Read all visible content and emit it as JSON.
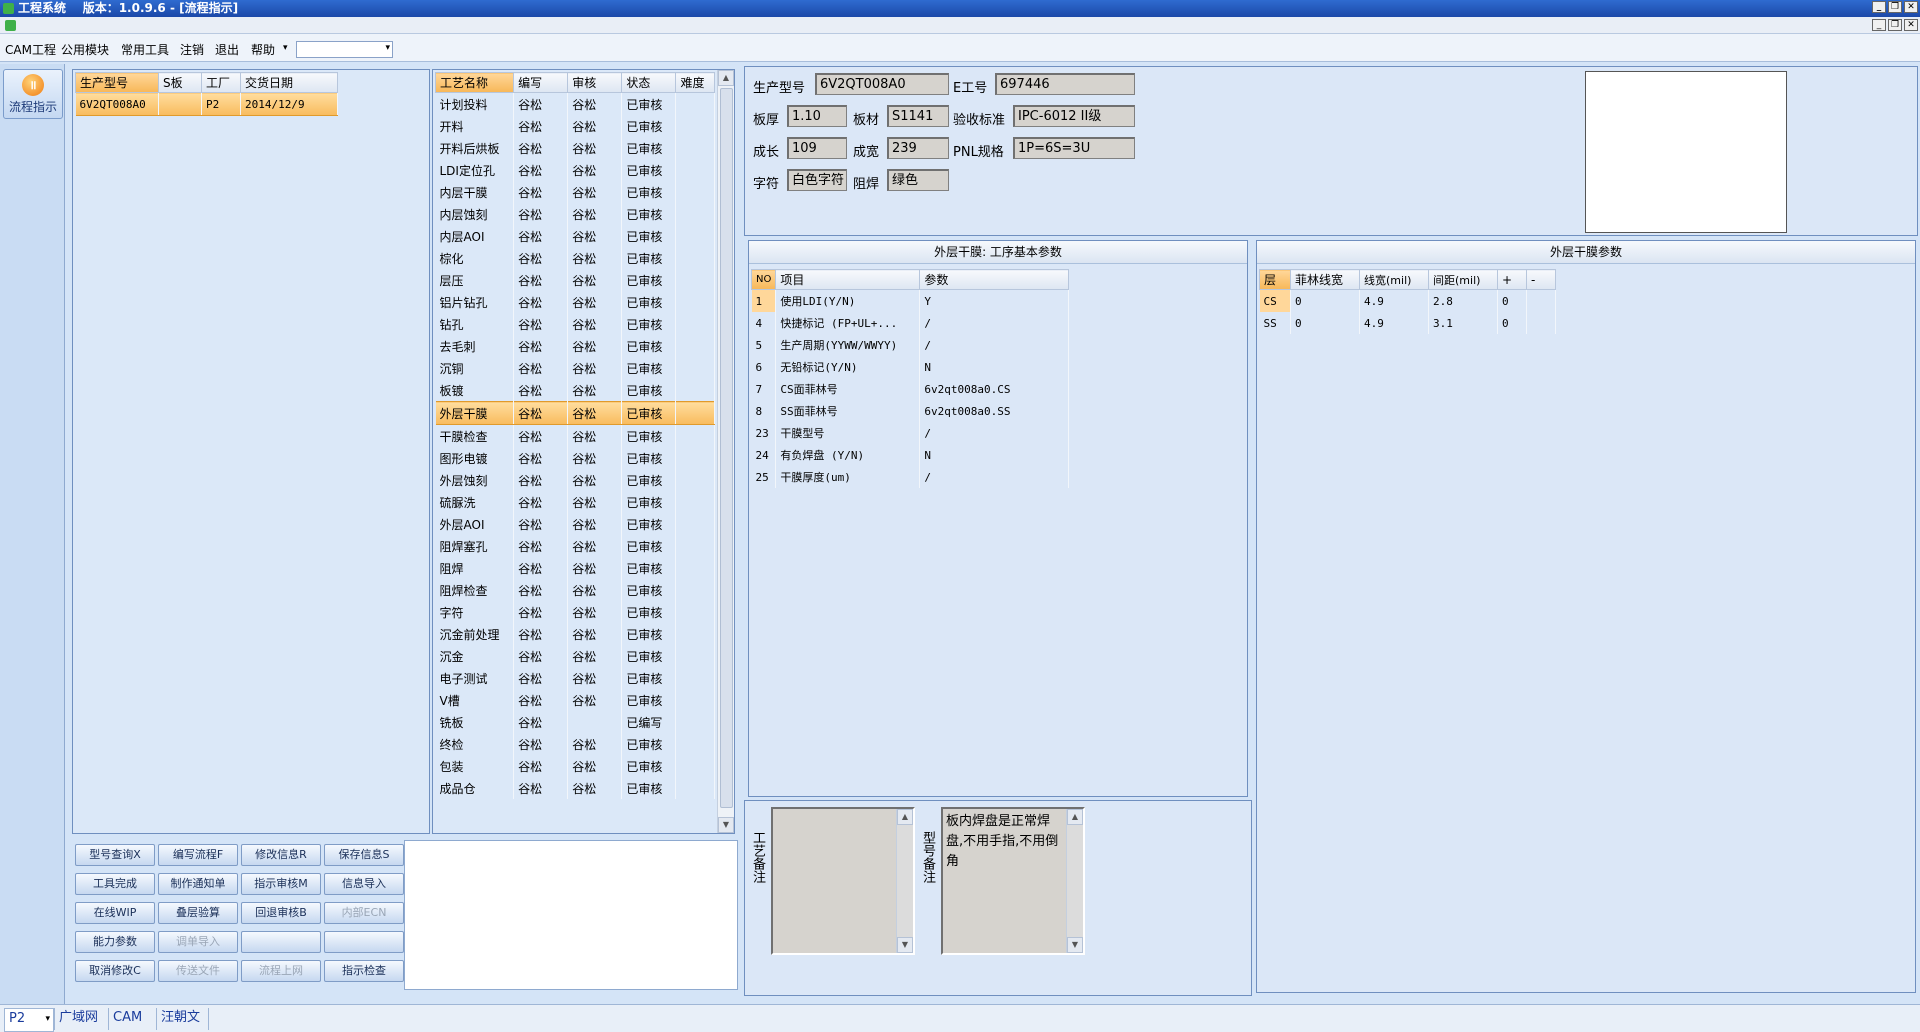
{
  "title_bar": {
    "text": "工程系统    版本：1.0.9.6 - [流程指示]"
  },
  "menu": {
    "items": [
      "CAM工程",
      "公用模块",
      "常用工具",
      "注销",
      "退出",
      "帮助"
    ],
    "combo_value": ""
  },
  "left_nav": {
    "button_label": "流程指示"
  },
  "orders": {
    "headers": [
      "生产型号",
      "S板",
      "工厂",
      "交货日期"
    ],
    "rows": [
      {
        "model": "6V2QT008A0",
        "s_board": "",
        "factory": "P2",
        "date": "2014/12/9"
      }
    ]
  },
  "process": {
    "headers": [
      "工艺名称",
      "编写",
      "审核",
      "状态",
      "难度"
    ],
    "selected_index": 14,
    "rows": [
      {
        "name": "计划投料",
        "writer": "谷松",
        "reviewer": "谷松",
        "status": "已审核"
      },
      {
        "name": "开料",
        "writer": "谷松",
        "reviewer": "谷松",
        "status": "已审核"
      },
      {
        "name": "开料后烘板",
        "writer": "谷松",
        "reviewer": "谷松",
        "status": "已审核"
      },
      {
        "name": "LDI定位孔",
        "writer": "谷松",
        "reviewer": "谷松",
        "status": "已审核"
      },
      {
        "name": "内层干膜",
        "writer": "谷松",
        "reviewer": "谷松",
        "status": "已审核"
      },
      {
        "name": "内层蚀刻",
        "writer": "谷松",
        "reviewer": "谷松",
        "status": "已审核"
      },
      {
        "name": "内层AOI",
        "writer": "谷松",
        "reviewer": "谷松",
        "status": "已审核"
      },
      {
        "name": "棕化",
        "writer": "谷松",
        "reviewer": "谷松",
        "status": "已审核"
      },
      {
        "name": "层压",
        "writer": "谷松",
        "reviewer": "谷松",
        "status": "已审核"
      },
      {
        "name": "铝片钻孔",
        "writer": "谷松",
        "reviewer": "谷松",
        "status": "已审核"
      },
      {
        "name": "钻孔",
        "writer": "谷松",
        "reviewer": "谷松",
        "status": "已审核"
      },
      {
        "name": "去毛刺",
        "writer": "谷松",
        "reviewer": "谷松",
        "status": "已审核"
      },
      {
        "name": "沉铜",
        "writer": "谷松",
        "reviewer": "谷松",
        "status": "已审核"
      },
      {
        "name": "板镀",
        "writer": "谷松",
        "reviewer": "谷松",
        "status": "已审核"
      },
      {
        "name": "外层干膜",
        "writer": "谷松",
        "reviewer": "谷松",
        "status": "已审核"
      },
      {
        "name": "干膜检查",
        "writer": "谷松",
        "reviewer": "谷松",
        "status": "已审核"
      },
      {
        "name": "图形电镀",
        "writer": "谷松",
        "reviewer": "谷松",
        "status": "已审核"
      },
      {
        "name": "外层蚀刻",
        "writer": "谷松",
        "reviewer": "谷松",
        "status": "已审核"
      },
      {
        "name": "硫脲洗",
        "writer": "谷松",
        "reviewer": "谷松",
        "status": "已审核"
      },
      {
        "name": "外层AOI",
        "writer": "谷松",
        "reviewer": "谷松",
        "status": "已审核"
      },
      {
        "name": "阻焊塞孔",
        "writer": "谷松",
        "reviewer": "谷松",
        "status": "已审核"
      },
      {
        "name": "阻焊",
        "writer": "谷松",
        "reviewer": "谷松",
        "status": "已审核"
      },
      {
        "name": "阻焊检查",
        "writer": "谷松",
        "reviewer": "谷松",
        "status": "已审核"
      },
      {
        "name": "字符",
        "writer": "谷松",
        "reviewer": "谷松",
        "status": "已审核"
      },
      {
        "name": "沉金前处理",
        "writer": "谷松",
        "reviewer": "谷松",
        "status": "已审核"
      },
      {
        "name": "沉金",
        "writer": "谷松",
        "reviewer": "谷松",
        "status": "已审核"
      },
      {
        "name": "电子测试",
        "writer": "谷松",
        "reviewer": "谷松",
        "status": "已审核"
      },
      {
        "name": "V槽",
        "writer": "谷松",
        "reviewer": "谷松",
        "status": "已审核"
      },
      {
        "name": "铣板",
        "writer": "谷松",
        "reviewer": "",
        "status": "已编写"
      },
      {
        "name": "终检",
        "writer": "谷松",
        "reviewer": "谷松",
        "status": "已审核"
      },
      {
        "name": "包装",
        "writer": "谷松",
        "reviewer": "谷松",
        "status": "已审核"
      },
      {
        "name": "成品仓",
        "writer": "谷松",
        "reviewer": "谷松",
        "status": "已审核"
      }
    ]
  },
  "buttons": {
    "rows": [
      [
        {
          "label": "型号查询X",
          "enabled": true
        },
        {
          "label": "编写流程F",
          "enabled": true
        },
        {
          "label": "修改信息R",
          "enabled": true
        },
        {
          "label": "保存信息S",
          "enabled": true
        }
      ],
      [
        {
          "label": "工具完成",
          "enabled": true
        },
        {
          "label": "制作通知单",
          "enabled": true
        },
        {
          "label": "指示审核M",
          "enabled": true
        },
        {
          "label": "信息导入",
          "enabled": true
        }
      ],
      [
        {
          "label": "在线WIP",
          "enabled": true
        },
        {
          "label": "叠层验算",
          "enabled": true
        },
        {
          "label": "回退审核B",
          "enabled": true
        },
        {
          "label": "内部ECN",
          "enabled": false
        }
      ],
      [
        {
          "label": "能力参数",
          "enabled": true
        },
        {
          "label": "调单导入",
          "enabled": false
        },
        {
          "label": "",
          "enabled": false
        },
        {
          "label": "",
          "enabled": false
        }
      ],
      [
        {
          "label": "取消修改C",
          "enabled": true
        },
        {
          "label": "传送文件",
          "enabled": false
        },
        {
          "label": "流程上网",
          "enabled": false
        },
        {
          "label": "指示检查",
          "enabled": true
        }
      ]
    ]
  },
  "info": {
    "model_label": "生产型号",
    "model_value": "6V2QT008A0",
    "eno_label": "E工号",
    "eno_value": "697446",
    "thickness_label": "板厚",
    "thickness_value": "1.10",
    "material_label": "板材",
    "material_value": "S1141",
    "standard_label": "验收标准",
    "standard_value": "IPC-6012 II级",
    "length_label": "成长",
    "length_value": "109",
    "width_label": "成宽",
    "width_value": "239",
    "pnl_label": "PNL规格",
    "pnl_value": "1P=6S=3U",
    "char_label": "字符",
    "char_value": "白色字符",
    "mask_label": "阻焊",
    "mask_value": "绿色"
  },
  "params": {
    "title": "外层干膜: 工序基本参数",
    "headers": [
      "NO",
      "项目",
      "参数"
    ],
    "rows": [
      {
        "no": "1",
        "item": "使用LDI(Y/N)",
        "value": "Y"
      },
      {
        "no": "4",
        "item": "快捷标记 (FP+UL+...",
        "value": "/"
      },
      {
        "no": "5",
        "item": "生产周期(YYWW/WWYY)",
        "value": "/"
      },
      {
        "no": "6",
        "item": "无铅标记(Y/N)",
        "value": "N"
      },
      {
        "no": "7",
        "item": "CS面菲林号",
        "value": "6v2qt008a0.CS"
      },
      {
        "no": "8",
        "item": "SS面菲林号",
        "value": "6v2qt008a0.SS"
      },
      {
        "no": "23",
        "item": "干膜型号",
        "value": "/"
      },
      {
        "no": "24",
        "item": "有负焊盘 (Y/N)",
        "value": "N"
      },
      {
        "no": "25",
        "item": "干膜厚度(um)",
        "value": "/"
      }
    ]
  },
  "film_params": {
    "title": "外层干膜参数",
    "headers": [
      "层",
      "菲林线宽",
      "线宽(mil)",
      "间距(mil)",
      "+",
      "-"
    ],
    "rows": [
      {
        "layer": "CS",
        "film": "0",
        "width": "4.9",
        "space": "2.8",
        "plus": "0",
        "minus": ""
      },
      {
        "layer": "SS",
        "film": "0",
        "width": "4.9",
        "space": "3.1",
        "plus": "0",
        "minus": ""
      }
    ]
  },
  "remarks": {
    "process_label": "工艺备注",
    "process_text": "",
    "model_label": "型号备注",
    "model_text": "板内焊盘是正常焊盘,不用手指,不用倒角"
  },
  "status_bar": {
    "combo_value": "P2",
    "items": [
      "广域网",
      "CAM",
      "汪朝文"
    ]
  }
}
